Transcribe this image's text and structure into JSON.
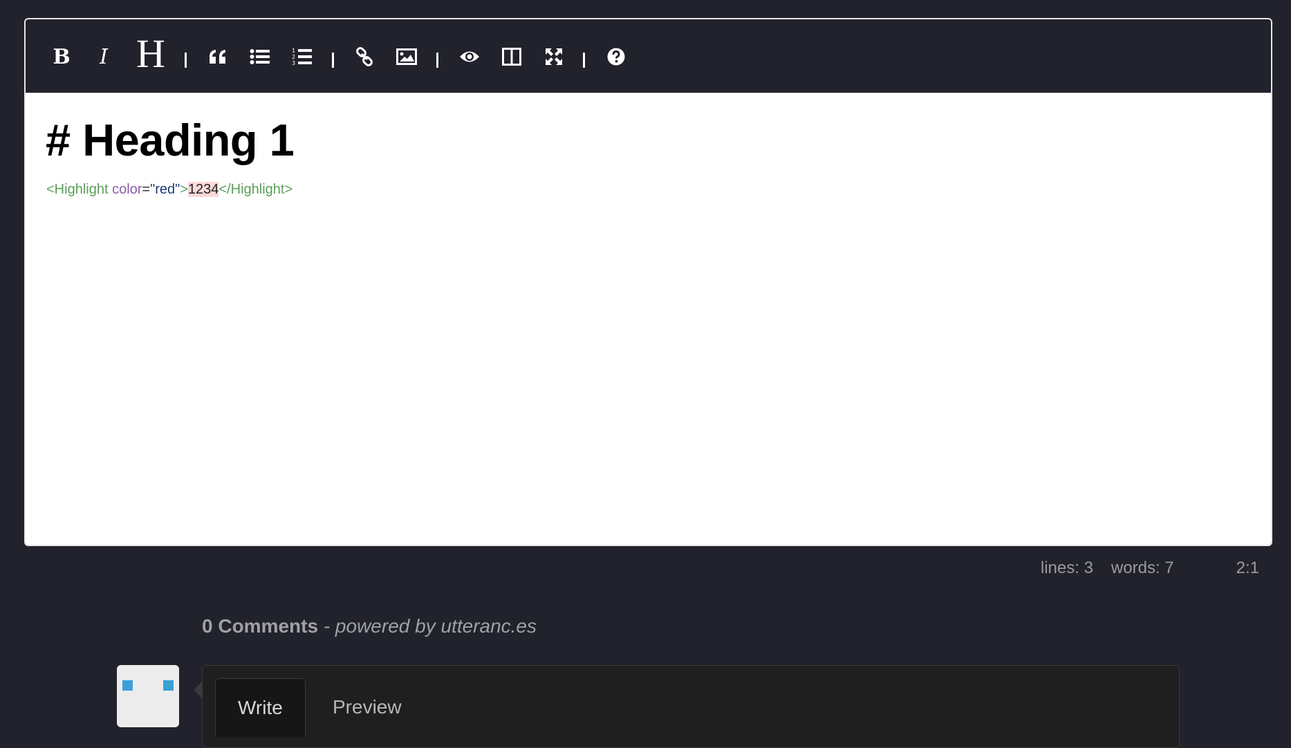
{
  "toolbar": {
    "bold_label": "B",
    "italic_label": "I",
    "heading_label": "H",
    "icons": [
      "bold-icon",
      "italic-icon",
      "heading-icon",
      "quote-icon",
      "unordered-list-icon",
      "ordered-list-icon",
      "link-icon",
      "image-icon",
      "preview-icon",
      "side-by-side-icon",
      "fullscreen-icon",
      "help-icon"
    ]
  },
  "editor": {
    "heading_text": "# Heading 1",
    "code": {
      "open_tag_start": "<Highlight",
      "attr_name": " color",
      "eq": "=",
      "attr_value": "\"red\"",
      "open_tag_end": ">",
      "inner_text": "1234",
      "close_tag": "</Highlight>"
    }
  },
  "statusbar": {
    "lines": "lines: 3",
    "words": "words: 7",
    "cursor": "2:1"
  },
  "comments": {
    "count_label": "0 Comments",
    "powered_label": " - powered by utteranc.es",
    "tabs": [
      {
        "label": "Write"
      },
      {
        "label": "Preview"
      }
    ]
  },
  "colors": {
    "background": "#21222c",
    "highlight": "#fcd9d9",
    "avatar_accent": "#3aa0d6"
  }
}
